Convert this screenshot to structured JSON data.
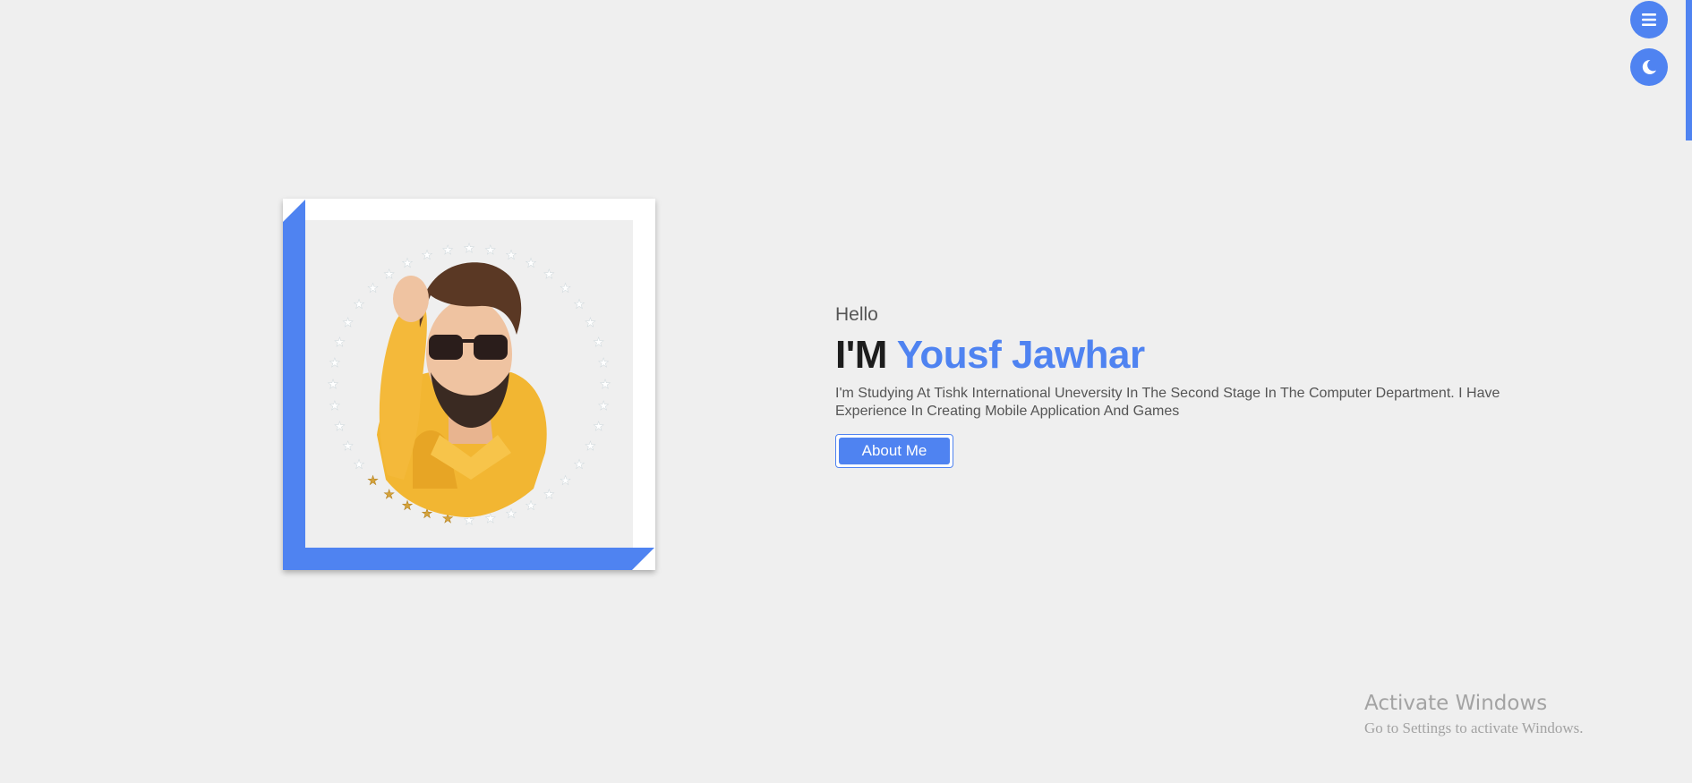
{
  "nav": {
    "menu_icon": "hamburger-icon",
    "theme_icon": "moon-icon"
  },
  "hero": {
    "greeting": "Hello",
    "headline_prefix": "I'M ",
    "name": "Yousf Jawhar",
    "bio": "I'm Studying At Tishk International Uneversity In The Second Stage In The Computer Department. I Have Experience In Creating Mobile Application And Games",
    "about_button": "About Me"
  },
  "watermark": {
    "title": "Activate Windows",
    "subtitle": "Go to Settings to activate Windows."
  },
  "colors": {
    "accent": "#4f83f1",
    "background": "#efefef",
    "heading": "#1d1d1d",
    "text": "#555555"
  }
}
